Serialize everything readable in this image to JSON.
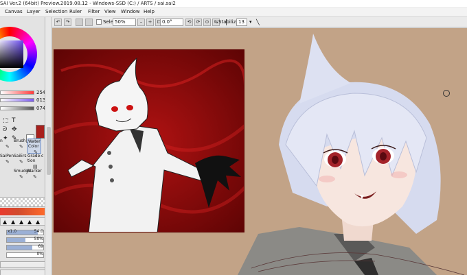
{
  "window": {
    "title": "SAI Ver.2 (64bit) Preview.2019.08.12 - Windows-SSD (C:) / ARTS / sai.sai2"
  },
  "menu": [
    "Canvas",
    "Layer",
    "Selection",
    "Ruler",
    "Filter",
    "View",
    "Window",
    "Help"
  ],
  "toolbar": {
    "selection_label": "Selection",
    "zoom_value": "50%",
    "zoom_minus": "–",
    "zoom_plus": "+",
    "zoom_fit": "⊡",
    "rotation_value": "0.0°",
    "stabilizer_label": "Stabilizer",
    "stabilizer_value": "13",
    "stabilizer_arrow": "▾"
  },
  "color_panel": {
    "sliders": [
      {
        "value": "254",
        "color": "#ff3b3b"
      },
      {
        "value": "013",
        "color": "#7c5cf0"
      },
      {
        "value": "074",
        "color": "#555555"
      }
    ],
    "primary_color": "#a8201c",
    "secondary_color": "#ffffff"
  },
  "tools": {
    "text_tool": "T",
    "selection_tool": "⬚",
    "lasso_tool": "ᘐ",
    "move_tool": "✥",
    "magic_wand": "✦",
    "eyedropper": "✎"
  },
  "brushes": [
    {
      "label": "n",
      "icon": "✎"
    },
    {
      "label": "Brush",
      "icon": "✎"
    },
    {
      "label": "Water Color",
      "icon": "✎",
      "selected": true
    },
    {
      "label": "",
      "icon": "✎"
    },
    {
      "label": "SaiPen",
      "icon": "✎"
    },
    {
      "label": "SaiErs",
      "icon": "✎"
    },
    {
      "label": "Grade-tion",
      "icon": "▤"
    },
    {
      "label": "c",
      "icon": "✎"
    },
    {
      "label": "",
      "icon": ""
    },
    {
      "label": "Smudge",
      "icon": "✎"
    },
    {
      "label": "Marker",
      "icon": "✎"
    },
    {
      "label": "",
      "icon": ""
    }
  ],
  "tip_shapes": [
    "▲",
    "▲",
    "▲",
    "▲",
    "▲"
  ],
  "brush_props": [
    {
      "label": "x1.0",
      "value": "54.0",
      "fill": 0.85
    },
    {
      "label": "",
      "value": "50%",
      "fill": 0.5
    },
    {
      "label": "",
      "value": "69",
      "fill": 0.69
    },
    {
      "label": "",
      "value": "0%",
      "fill": 0.0
    }
  ],
  "colors": {
    "workspace_bg": "#c2a387",
    "nav_bg": "#8c0a0a"
  }
}
